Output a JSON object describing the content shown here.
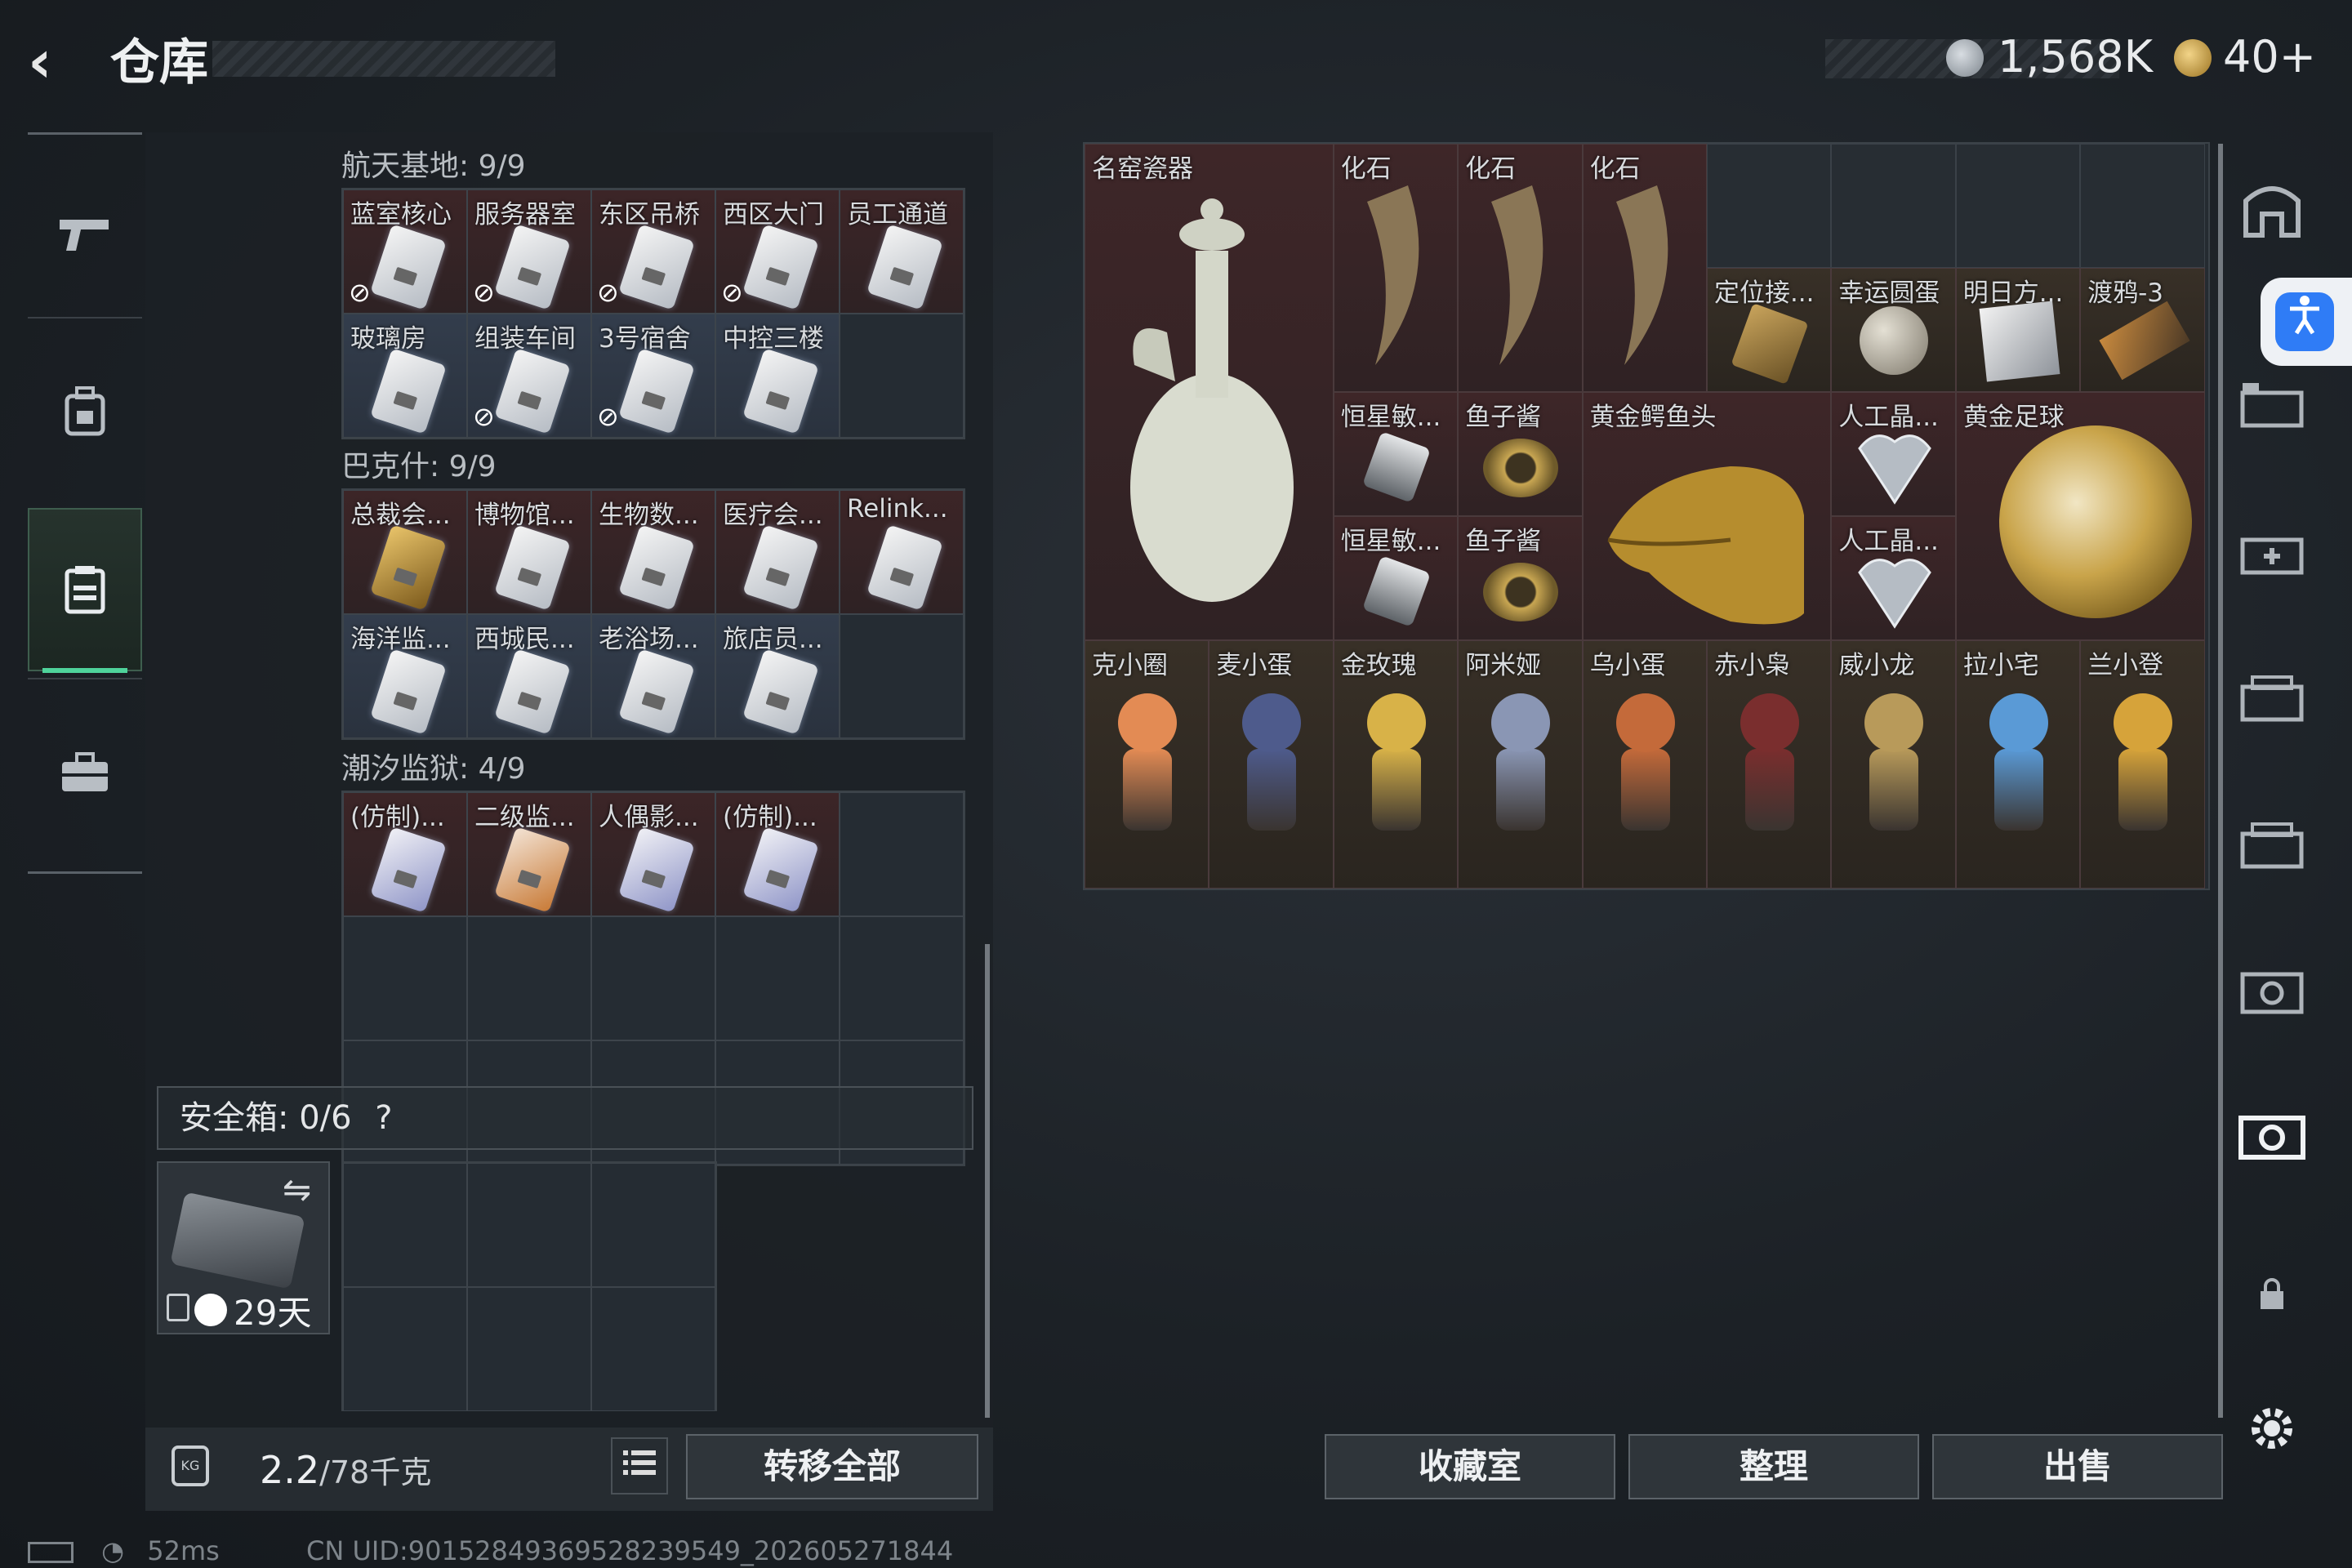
{
  "header": {
    "back_glyph": "‹",
    "title": "仓库"
  },
  "currency": {
    "coins": "1,568K",
    "tokens": "40+"
  },
  "left_nav": [
    "weapon-icon",
    "backpack-icon",
    "storage-icon",
    "toolbox-icon"
  ],
  "sections": [
    {
      "title": "航天基地: 9/9",
      "cells": [
        {
          "label": "蓝室核心",
          "card": "white",
          "locked": true
        },
        {
          "label": "服务器室",
          "card": "white",
          "locked": true
        },
        {
          "label": "东区吊桥",
          "card": "white",
          "locked": true
        },
        {
          "label": "西区大门",
          "card": "white",
          "locked": true
        },
        {
          "label": "员工通道",
          "card": "white",
          "locked": false
        },
        {
          "label": "玻璃房",
          "card": "white",
          "locked": false
        },
        {
          "label": "组装车间",
          "card": "white",
          "locked": true
        },
        {
          "label": "3号宿舍",
          "card": "white",
          "locked": true
        },
        {
          "label": "中控三楼",
          "card": "white",
          "locked": false
        }
      ]
    },
    {
      "title": "巴克什: 9/9",
      "cells": [
        {
          "label": "总裁会...",
          "card": "gold",
          "locked": false
        },
        {
          "label": "博物馆...",
          "card": "white",
          "locked": false
        },
        {
          "label": "生物数...",
          "card": "white",
          "locked": false
        },
        {
          "label": "医疗会...",
          "card": "white",
          "locked": false
        },
        {
          "label": "Relink...",
          "card": "white",
          "locked": false
        },
        {
          "label": "海洋监...",
          "card": "white",
          "locked": false
        },
        {
          "label": "西城民...",
          "card": "white",
          "locked": false
        },
        {
          "label": "老浴场...",
          "card": "white",
          "locked": false
        },
        {
          "label": "旅店员...",
          "card": "white",
          "locked": false
        }
      ]
    },
    {
      "title": "潮汐监狱: 4/9",
      "cells": [
        {
          "label": "(仿制)...",
          "card": "purple",
          "locked": false
        },
        {
          "label": "二级监...",
          "card": "orange",
          "locked": false
        },
        {
          "label": "人偶影...",
          "card": "purple",
          "locked": false
        },
        {
          "label": "(仿制)...",
          "card": "purple",
          "locked": false
        }
      ]
    }
  ],
  "safe": {
    "header": "安全箱: 0/6",
    "help": "?",
    "swap_glyph": "⇋",
    "days": "29天"
  },
  "weight": {
    "value": "2.2",
    "unit": "/78千克",
    "icon_text": "KG"
  },
  "buttons": {
    "transfer_all": "转移全部",
    "collection": "收藏室",
    "organize": "整理",
    "sell": "出售"
  },
  "stash": {
    "vase": "名窑瓷器",
    "fossils": [
      "化石",
      "化石",
      "化石"
    ],
    "locator": "定位接...",
    "lucky_egg": "幸运圆蛋",
    "tomorrow": "明日方...",
    "crow": "渡鸦-3",
    "hengxing": [
      "恒星敏...",
      "恒星敏..."
    ],
    "caviar": [
      "鱼子酱",
      "鱼子酱"
    ],
    "croc": "黄金鳄鱼头",
    "crystal": [
      "人工晶...",
      "人工晶..."
    ],
    "ball": "黄金足球",
    "figures": [
      "克小圈",
      "麦小蛋",
      "金玫瑰",
      "阿米娅",
      "乌小蛋",
      "赤小枭",
      "威小龙",
      "拉小宅",
      "兰小登"
    ]
  },
  "right_nav": [
    "armor-icon",
    "case-icon",
    "medkit-case-icon",
    "folder-case-icon",
    "folder-case-icon-2",
    "keycard-case-icon",
    "keycard-case-active-icon",
    "lock-icon",
    "settings-icon"
  ],
  "status": {
    "ping": "52ms",
    "uid": "CN UID:90152849369528239549_202605271844"
  }
}
